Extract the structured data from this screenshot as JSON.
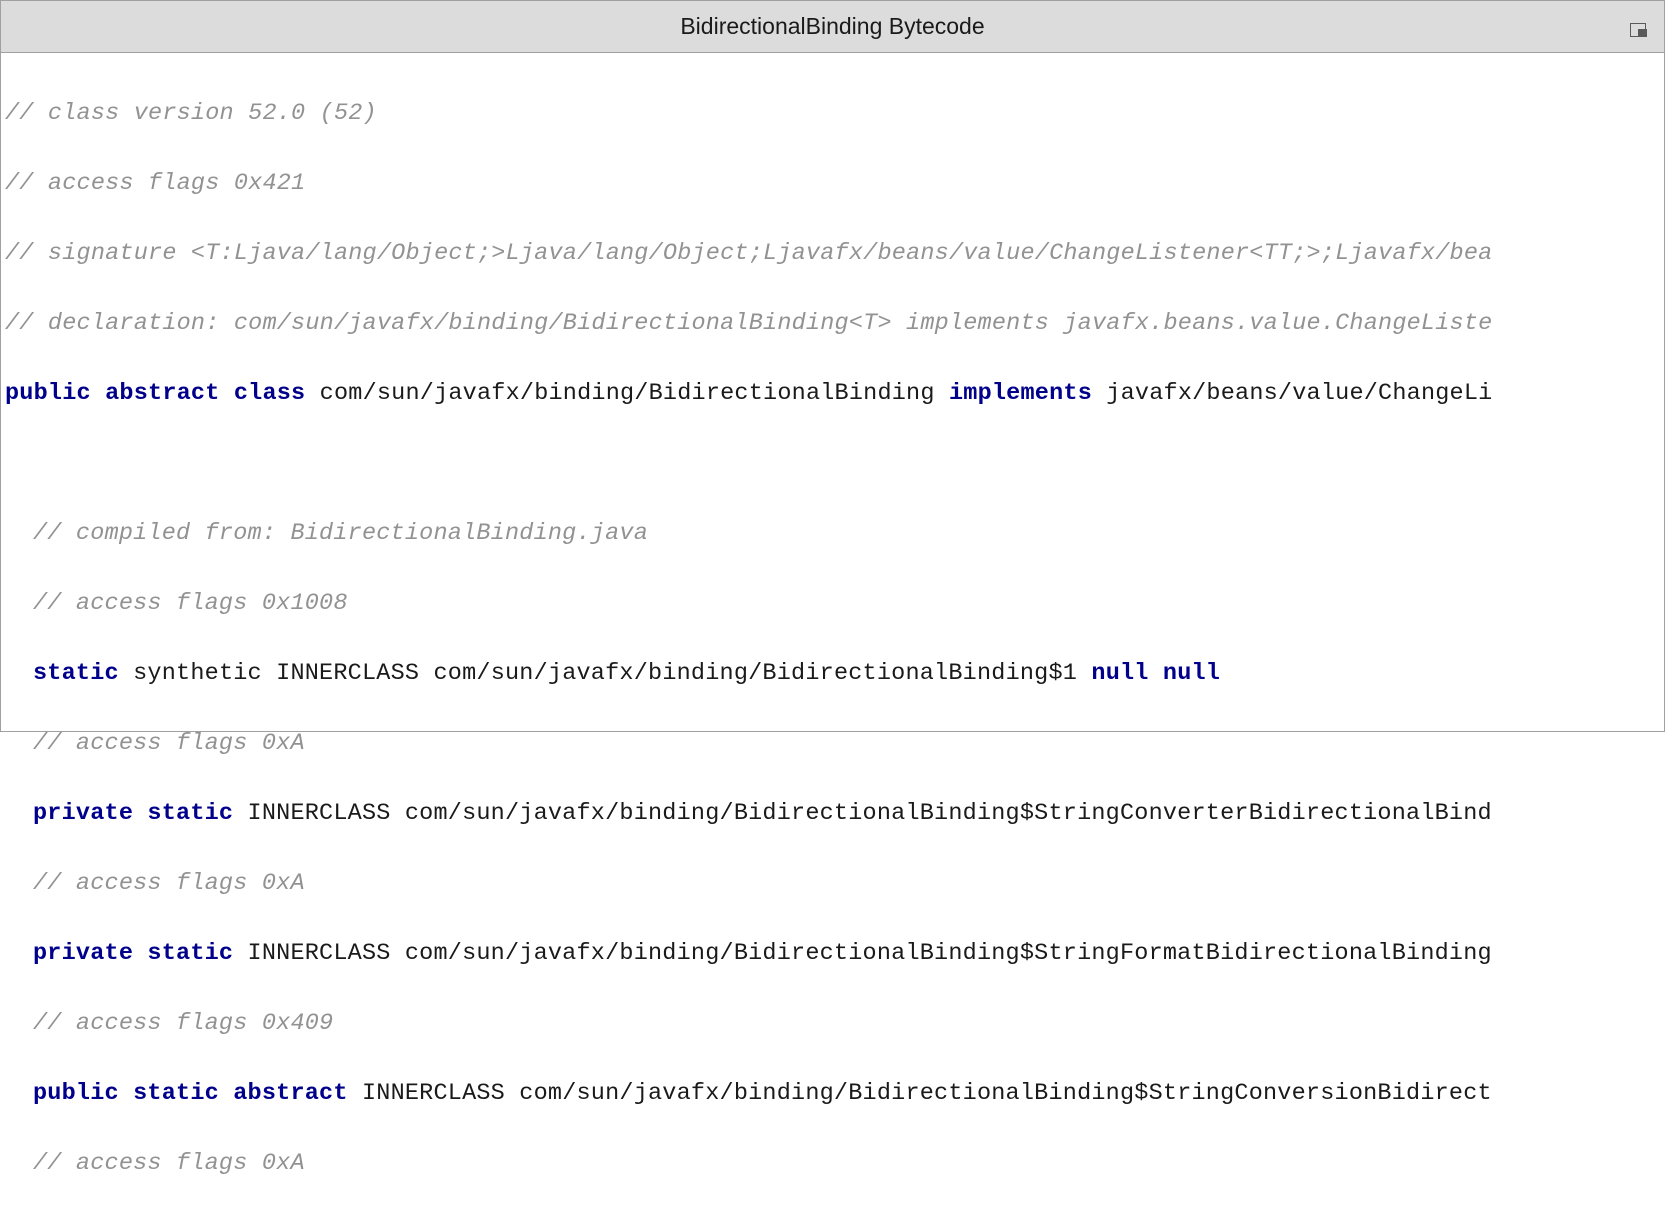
{
  "header": {
    "title": "BidirectionalBinding Bytecode"
  },
  "code": {
    "line1_comment": "// class version 52.0 (52)",
    "line2_comment": "// access flags 0x421",
    "line3_comment": "// signature <T:Ljava/lang/Object;>Ljava/lang/Object;Ljavafx/beans/value/ChangeListener<TT;>;Ljavafx/bea",
    "line4_comment": "// declaration: com/sun/javafx/binding/BidirectionalBinding<T> implements javafx.beans.value.ChangeListe",
    "line5_kw1": "public abstract class",
    "line5_txt1": " com/sun/javafx/binding/BidirectionalBinding ",
    "line5_kw2": "implements",
    "line5_txt2": " javafx/beans/value/ChangeLi",
    "line7_comment": "// compiled from: BidirectionalBinding.java",
    "line8_comment": "// access flags 0x1008",
    "line9_kw1": "static",
    "line9_txt1": " synthetic INNERCLASS com/sun/javafx/binding/BidirectionalBinding$1 ",
    "line9_kw2": "null null",
    "line10_comment": "// access flags 0xA",
    "line11_kw1": "private static",
    "line11_txt1": " INNERCLASS com/sun/javafx/binding/BidirectionalBinding$StringConverterBidirectionalBind",
    "line12_comment": "// access flags 0xA",
    "line13_kw1": "private static",
    "line13_txt1": " INNERCLASS com/sun/javafx/binding/BidirectionalBinding$StringFormatBidirectionalBinding",
    "line14_comment": "// access flags 0x409",
    "line15_kw1": "public static abstract",
    "line15_txt1": " INNERCLASS com/sun/javafx/binding/BidirectionalBinding$StringConversionBidirect",
    "line16_comment": "// access flags 0xA"
  }
}
